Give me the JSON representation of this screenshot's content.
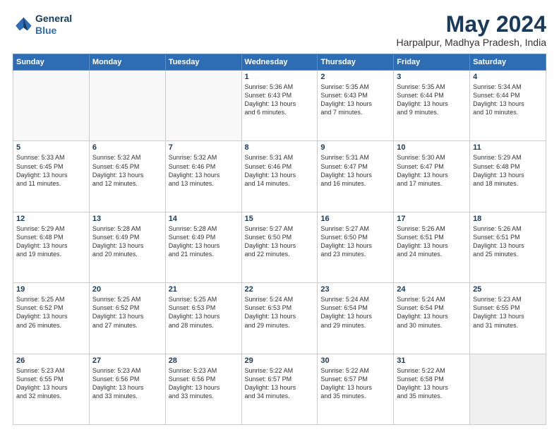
{
  "header": {
    "logo_line1": "General",
    "logo_line2": "Blue",
    "month_title": "May 2024",
    "location": "Harpalpur, Madhya Pradesh, India"
  },
  "days_of_week": [
    "Sunday",
    "Monday",
    "Tuesday",
    "Wednesday",
    "Thursday",
    "Friday",
    "Saturday"
  ],
  "weeks": [
    [
      {
        "num": "",
        "info": ""
      },
      {
        "num": "",
        "info": ""
      },
      {
        "num": "",
        "info": ""
      },
      {
        "num": "1",
        "info": "Sunrise: 5:36 AM\nSunset: 6:43 PM\nDaylight: 13 hours\nand 6 minutes."
      },
      {
        "num": "2",
        "info": "Sunrise: 5:35 AM\nSunset: 6:43 PM\nDaylight: 13 hours\nand 7 minutes."
      },
      {
        "num": "3",
        "info": "Sunrise: 5:35 AM\nSunset: 6:44 PM\nDaylight: 13 hours\nand 9 minutes."
      },
      {
        "num": "4",
        "info": "Sunrise: 5:34 AM\nSunset: 6:44 PM\nDaylight: 13 hours\nand 10 minutes."
      }
    ],
    [
      {
        "num": "5",
        "info": "Sunrise: 5:33 AM\nSunset: 6:45 PM\nDaylight: 13 hours\nand 11 minutes."
      },
      {
        "num": "6",
        "info": "Sunrise: 5:32 AM\nSunset: 6:45 PM\nDaylight: 13 hours\nand 12 minutes."
      },
      {
        "num": "7",
        "info": "Sunrise: 5:32 AM\nSunset: 6:46 PM\nDaylight: 13 hours\nand 13 minutes."
      },
      {
        "num": "8",
        "info": "Sunrise: 5:31 AM\nSunset: 6:46 PM\nDaylight: 13 hours\nand 14 minutes."
      },
      {
        "num": "9",
        "info": "Sunrise: 5:31 AM\nSunset: 6:47 PM\nDaylight: 13 hours\nand 16 minutes."
      },
      {
        "num": "10",
        "info": "Sunrise: 5:30 AM\nSunset: 6:47 PM\nDaylight: 13 hours\nand 17 minutes."
      },
      {
        "num": "11",
        "info": "Sunrise: 5:29 AM\nSunset: 6:48 PM\nDaylight: 13 hours\nand 18 minutes."
      }
    ],
    [
      {
        "num": "12",
        "info": "Sunrise: 5:29 AM\nSunset: 6:48 PM\nDaylight: 13 hours\nand 19 minutes."
      },
      {
        "num": "13",
        "info": "Sunrise: 5:28 AM\nSunset: 6:49 PM\nDaylight: 13 hours\nand 20 minutes."
      },
      {
        "num": "14",
        "info": "Sunrise: 5:28 AM\nSunset: 6:49 PM\nDaylight: 13 hours\nand 21 minutes."
      },
      {
        "num": "15",
        "info": "Sunrise: 5:27 AM\nSunset: 6:50 PM\nDaylight: 13 hours\nand 22 minutes."
      },
      {
        "num": "16",
        "info": "Sunrise: 5:27 AM\nSunset: 6:50 PM\nDaylight: 13 hours\nand 23 minutes."
      },
      {
        "num": "17",
        "info": "Sunrise: 5:26 AM\nSunset: 6:51 PM\nDaylight: 13 hours\nand 24 minutes."
      },
      {
        "num": "18",
        "info": "Sunrise: 5:26 AM\nSunset: 6:51 PM\nDaylight: 13 hours\nand 25 minutes."
      }
    ],
    [
      {
        "num": "19",
        "info": "Sunrise: 5:25 AM\nSunset: 6:52 PM\nDaylight: 13 hours\nand 26 minutes."
      },
      {
        "num": "20",
        "info": "Sunrise: 5:25 AM\nSunset: 6:52 PM\nDaylight: 13 hours\nand 27 minutes."
      },
      {
        "num": "21",
        "info": "Sunrise: 5:25 AM\nSunset: 6:53 PM\nDaylight: 13 hours\nand 28 minutes."
      },
      {
        "num": "22",
        "info": "Sunrise: 5:24 AM\nSunset: 6:53 PM\nDaylight: 13 hours\nand 29 minutes."
      },
      {
        "num": "23",
        "info": "Sunrise: 5:24 AM\nSunset: 6:54 PM\nDaylight: 13 hours\nand 29 minutes."
      },
      {
        "num": "24",
        "info": "Sunrise: 5:24 AM\nSunset: 6:54 PM\nDaylight: 13 hours\nand 30 minutes."
      },
      {
        "num": "25",
        "info": "Sunrise: 5:23 AM\nSunset: 6:55 PM\nDaylight: 13 hours\nand 31 minutes."
      }
    ],
    [
      {
        "num": "26",
        "info": "Sunrise: 5:23 AM\nSunset: 6:55 PM\nDaylight: 13 hours\nand 32 minutes."
      },
      {
        "num": "27",
        "info": "Sunrise: 5:23 AM\nSunset: 6:56 PM\nDaylight: 13 hours\nand 33 minutes."
      },
      {
        "num": "28",
        "info": "Sunrise: 5:23 AM\nSunset: 6:56 PM\nDaylight: 13 hours\nand 33 minutes."
      },
      {
        "num": "29",
        "info": "Sunrise: 5:22 AM\nSunset: 6:57 PM\nDaylight: 13 hours\nand 34 minutes."
      },
      {
        "num": "30",
        "info": "Sunrise: 5:22 AM\nSunset: 6:57 PM\nDaylight: 13 hours\nand 35 minutes."
      },
      {
        "num": "31",
        "info": "Sunrise: 5:22 AM\nSunset: 6:58 PM\nDaylight: 13 hours\nand 35 minutes."
      },
      {
        "num": "",
        "info": ""
      }
    ]
  ]
}
